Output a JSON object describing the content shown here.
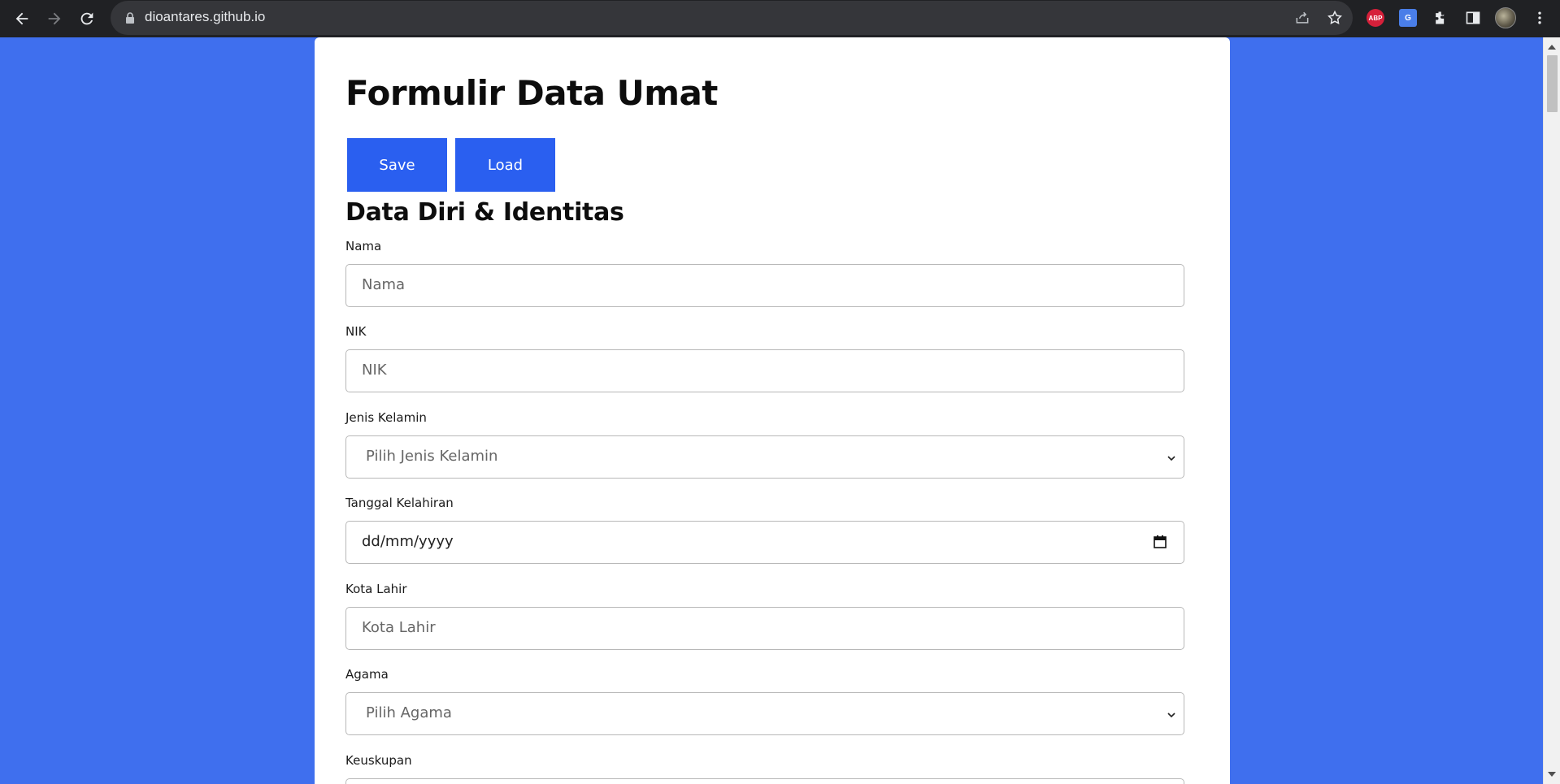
{
  "browser": {
    "url": "dioantares.github.io"
  },
  "form": {
    "title": "Formulir Data Umat",
    "save_label": "Save",
    "load_label": "Load",
    "section_title": "Data Diri & Identitas",
    "fields": {
      "nama": {
        "label": "Nama",
        "placeholder": "Nama"
      },
      "nik": {
        "label": "NIK",
        "placeholder": "NIK"
      },
      "jenis_kelamin": {
        "label": "Jenis Kelamin",
        "selected": "Pilih Jenis Kelamin"
      },
      "tanggal_lahir": {
        "label": "Tanggal Kelahiran",
        "value": "dd/mm/yyyy"
      },
      "kota_lahir": {
        "label": "Kota Lahir",
        "placeholder": "Kota Lahir"
      },
      "agama": {
        "label": "Agama",
        "selected": "Pilih Agama"
      },
      "keuskupan": {
        "label": "Keuskupan"
      }
    }
  },
  "colors": {
    "background": "#3f6fee",
    "button": "#2a5ff0",
    "browser_bar": "#202124"
  },
  "icons": [
    "back-icon",
    "forward-icon",
    "reload-icon",
    "lock-icon",
    "share-icon",
    "star-icon",
    "adblock-plus-icon",
    "google-translate-icon",
    "extensions-icon",
    "side-panel-icon",
    "profile-avatar",
    "more-menu-icon",
    "chevron-down-icon",
    "calendar-icon"
  ]
}
